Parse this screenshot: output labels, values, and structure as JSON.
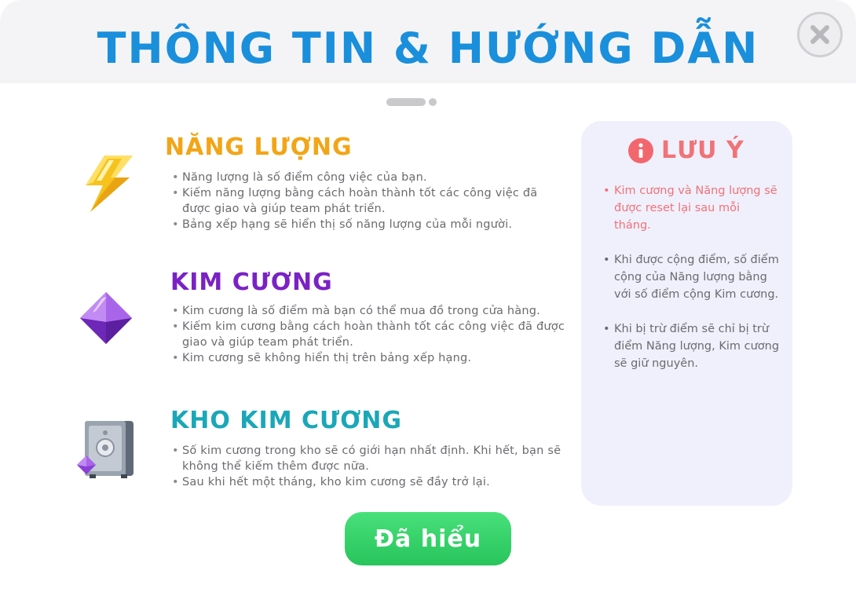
{
  "header": {
    "title": "THÔNG TIN & HƯỚNG DẪN",
    "close_icon": "close-icon"
  },
  "pager": {
    "total": 2,
    "current": 1
  },
  "sections": [
    {
      "title": "NĂNG LƯỢNG",
      "color": "#f2a516",
      "icon": "lightning-icon",
      "bullets": [
        "Năng lượng là số điểm công việc của bạn.",
        "Kiếm năng lượng bằng cách hoàn thành tốt các công việc đã được giao và giúp team phát triển.",
        "Bảng xếp hạng sẽ hiển thị số năng lượng của mỗi người."
      ]
    },
    {
      "title": "KIM CƯƠNG",
      "color": "#7a22c4",
      "icon": "diamond-icon",
      "bullets": [
        "Kim cương là số điểm mà bạn có thể mua đồ trong cửa hàng.",
        "Kiếm kim cương bằng cách hoàn thành tốt các công việc đã được giao và giúp team phát triển.",
        "Kim cương sẽ không hiển thị trên bảng xếp hạng."
      ]
    },
    {
      "title": "KHO KIM CƯƠNG",
      "color": "#1aa7b8",
      "icon": "safe-icon",
      "bullets": [
        "Số kim cương trong kho sẽ có giới hạn nhất định. Khi hết, bạn sẽ không thể kiếm thêm được nữa.",
        "Sau khi hết một tháng, kho kim cương sẽ đầy trở lại."
      ]
    }
  ],
  "note": {
    "title": "LƯU Ý",
    "icon": "info-icon",
    "items": [
      "Kim cương và Năng lượng sẽ được reset lại sau mỗi tháng.",
      "Khi được cộng điểm, số điểm cộng của Năng lượng bằng với số điểm cộng Kim cương.",
      "Khi bị trừ điểm sẽ chỉ bị trừ điểm Năng lượng, Kim cương sẽ giữ nguyên."
    ]
  },
  "footer": {
    "confirm_label": "Đã hiểu"
  },
  "colors": {
    "title_blue": "#1a8fdc",
    "warn_red": "#f0727a",
    "button_green": "#34d168"
  }
}
